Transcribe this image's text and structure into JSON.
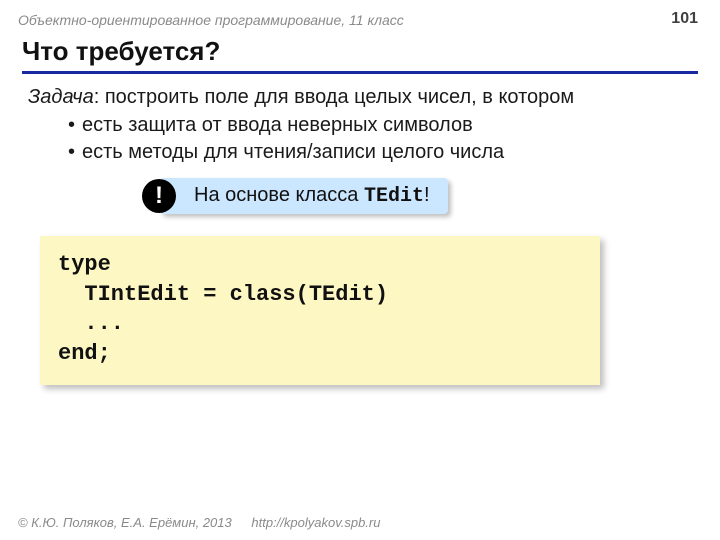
{
  "header": {
    "course": "Объектно-ориентированное программирование, 11 класс",
    "page_number": "101"
  },
  "title": "Что требуется?",
  "task": {
    "label": "Задача",
    "text": ": построить поле для ввода целых чисел, в котором"
  },
  "bullets": [
    "есть защита от ввода неверных символов",
    "есть методы для чтения/записи целого числа"
  ],
  "note": {
    "bang": "!",
    "prefix": "На основе класса ",
    "class_name": "TEdit",
    "suffix": "!"
  },
  "code": "type\n  TIntEdit = class(TEdit)\n  ...\nend;",
  "footer": {
    "copyright": "© К.Ю. Поляков, Е.А. Ерёмин, 2013",
    "url": "http://kpolyakov.spb.ru"
  }
}
